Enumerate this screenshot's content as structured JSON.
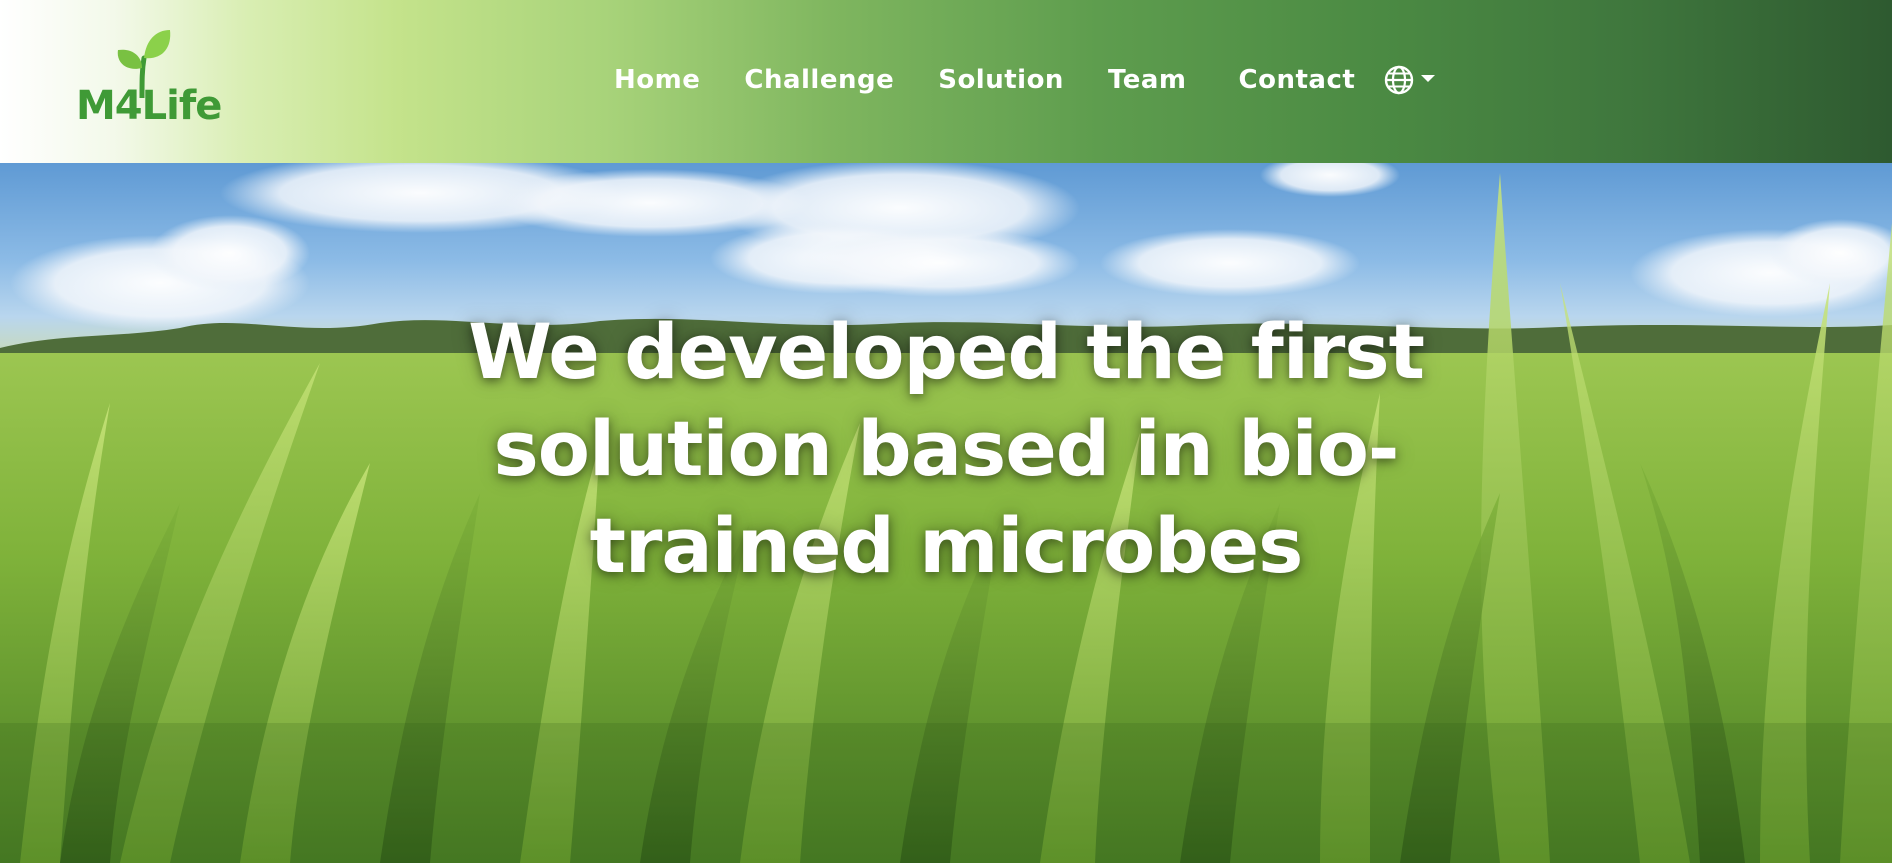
{
  "brand": {
    "logo_text": "M4Life",
    "logo_color": "#3f9a36"
  },
  "nav": {
    "items": [
      {
        "label": "Home"
      },
      {
        "label": "Challenge"
      },
      {
        "label": "Solution"
      },
      {
        "label": "Team"
      },
      {
        "label": "Contact"
      }
    ],
    "language_icon": "globe-icon",
    "dropdown_icon": "caret-down-icon",
    "gradient_colors": [
      "#ffffff",
      "#c4e38b",
      "#5e9d4e",
      "#2e5a30"
    ]
  },
  "hero": {
    "heading": "We developed the first solution based in bio-trained microbes",
    "text_color": "#ffffff",
    "background": "grass-field-under-blue-sky"
  }
}
